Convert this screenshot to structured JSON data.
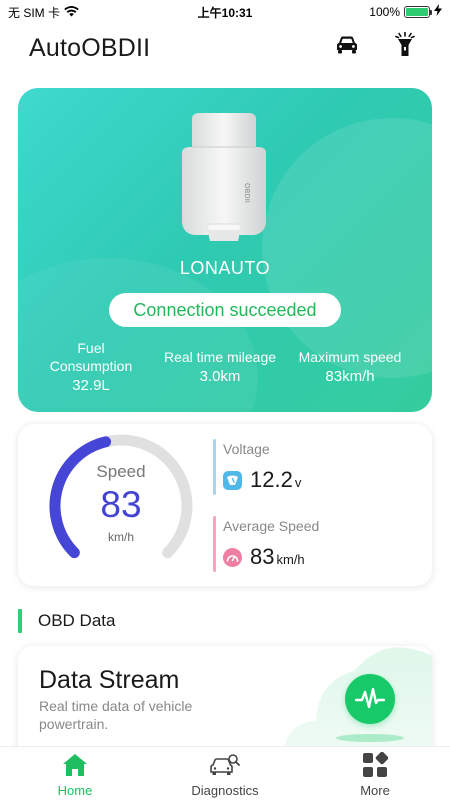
{
  "status_bar": {
    "carrier": "无 SIM 卡",
    "time": "上午10:31",
    "battery_percent": "100%",
    "battery_level": 1.0,
    "wifi_icon": "wifi-icon",
    "charging_icon": "bolt-icon"
  },
  "header": {
    "title": "AutoOBDII",
    "car_icon": "car-icon",
    "flashlight_icon": "flashlight-icon"
  },
  "device": {
    "name": "LONAUTO",
    "connection_status": "Connection succeeded",
    "image_label": "OBDII",
    "stats": [
      {
        "label": "Fuel Consumption",
        "value": "32.9L"
      },
      {
        "label": "Real time mileage",
        "value": "3.0km"
      },
      {
        "label": "Maximum speed",
        "value": "83km/h"
      }
    ]
  },
  "speed_card": {
    "label": "Speed",
    "value": "83",
    "unit": "km/h",
    "gauge_fraction": 0.45,
    "colors": {
      "gauge_active": "#4646d6",
      "gauge_track": "#e0e0e0"
    },
    "voltage": {
      "label": "Voltage",
      "value": "12.2",
      "unit": "v",
      "icon": "battery-gauge-icon",
      "color": "#4fb8e8"
    },
    "average_speed": {
      "label": "Average Speed",
      "value": "83",
      "unit": "km/h",
      "icon": "speedometer-icon",
      "color": "#ef7fa0"
    }
  },
  "obd_section": {
    "title": "OBD Data"
  },
  "data_stream": {
    "title": "Data Stream",
    "description": "Real time data of vehicle powertrain.",
    "icon": "pulse-icon",
    "color": "#18c96a"
  },
  "tabbar": {
    "tabs": [
      {
        "label": "Home",
        "icon": "home-icon",
        "active": true
      },
      {
        "label": "Diagnostics",
        "icon": "car-search-icon",
        "active": false
      },
      {
        "label": "More",
        "icon": "grid-icon",
        "active": false
      }
    ],
    "active_color": "#1fbf61"
  }
}
